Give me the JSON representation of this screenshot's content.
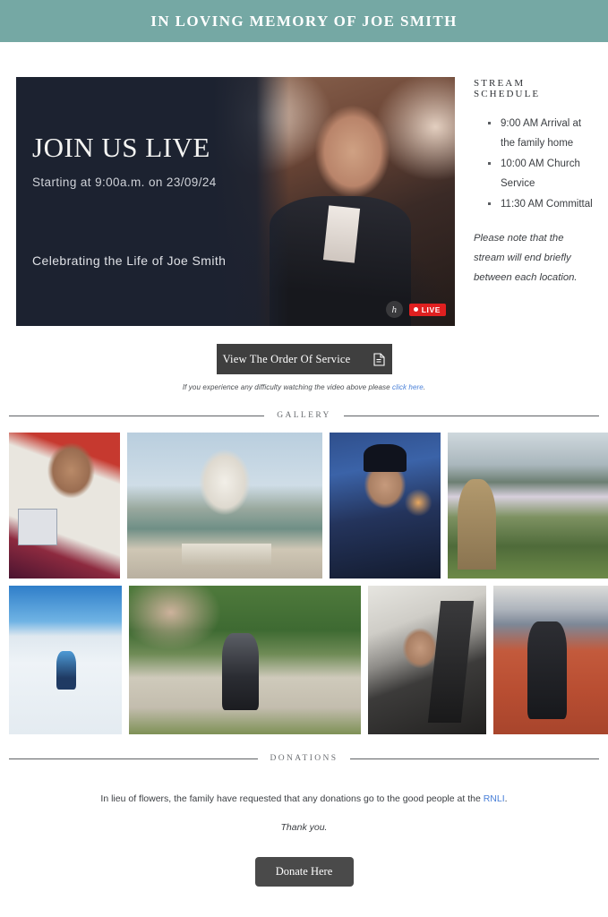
{
  "header": {
    "title": "IN LOVING MEMORY OF JOE SMITH"
  },
  "hero": {
    "video": {
      "title": "JOIN US LIVE",
      "subtitle": "Starting at 9:00a.m. on 23/09/24",
      "celebrating": "Celebrating the Life of Joe Smith",
      "brand_badge": "h",
      "live_label": "LIVE"
    },
    "schedule": {
      "heading": "STREAM SCHEDULE",
      "items": [
        "9:00 AM Arrival at the family home",
        "10:00 AM Church Service",
        "11:30 AM Committal"
      ],
      "note": "Please note that the stream will end briefly between each location."
    }
  },
  "order_of_service": {
    "button_label": "View The Order Of Service",
    "help_text_before": "If you experience any difficulty watching the video above please ",
    "help_link": "click here",
    "help_text_after": "."
  },
  "gallery": {
    "divider_label": "GALLERY",
    "rows": [
      {
        "images": [
          {
            "alt": "childhood-portrait"
          },
          {
            "alt": "taj-mahal-visit"
          },
          {
            "alt": "uniform-portrait"
          },
          {
            "alt": "lakeside-hillside"
          }
        ]
      },
      {
        "images": [
          {
            "alt": "skiing-slope"
          },
          {
            "alt": "road-race-running"
          },
          {
            "alt": "car-passenger-seat"
          },
          {
            "alt": "athletics-track"
          }
        ]
      }
    ]
  },
  "donations": {
    "divider_label": "DONATIONS",
    "copy_before": "In lieu of flowers, the family have requested that any donations go to the good people at the ",
    "charity_link": "RNLI",
    "copy_after": ".",
    "thanks": "Thank you.",
    "button_label": "Donate Here"
  },
  "colors": {
    "header_bg": "#75a8a4",
    "hero_bg": "#1c2230",
    "button_dark": "#3f3f3f",
    "donate_button": "#4a4a4a",
    "link_blue": "#4a80d8",
    "live_red": "#e02020"
  }
}
